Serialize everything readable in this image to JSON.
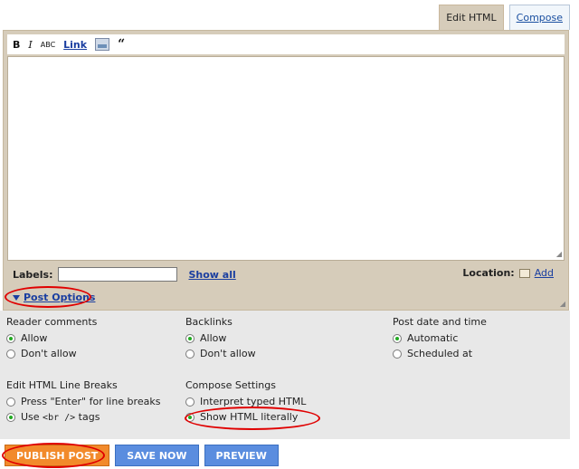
{
  "tabs": [
    {
      "label": "Edit HTML",
      "active": true
    },
    {
      "label": "Compose",
      "active": false
    }
  ],
  "toolbar": {
    "bold": "B",
    "italic": "I",
    "strike": "ABC",
    "link": "Link",
    "quote": "“"
  },
  "labels": {
    "label": "Labels:",
    "value": "",
    "show_all": "Show all"
  },
  "location": {
    "label": "Location:",
    "add": "Add"
  },
  "post_options": "Post Options",
  "groups": {
    "reader_comments": {
      "title": "Reader comments",
      "options": [
        {
          "label": "Allow",
          "selected": true
        },
        {
          "label": "Don't allow",
          "selected": false
        }
      ]
    },
    "backlinks": {
      "title": "Backlinks",
      "options": [
        {
          "label": "Allow",
          "selected": true
        },
        {
          "label": "Don't allow",
          "selected": false
        }
      ]
    },
    "post_date": {
      "title": "Post date and time",
      "options": [
        {
          "label": "Automatic",
          "selected": true
        },
        {
          "label": "Scheduled at",
          "selected": false
        }
      ]
    },
    "line_breaks": {
      "title": "Edit HTML Line Breaks",
      "options": [
        {
          "label": "Press \"Enter\" for line breaks",
          "selected": false
        },
        {
          "label_prefix": "Use ",
          "label_code": "<br />",
          "label_suffix": " tags",
          "selected": true
        }
      ]
    },
    "compose_settings": {
      "title": "Compose Settings",
      "options": [
        {
          "label": "Interpret typed HTML",
          "selected": false
        },
        {
          "label": "Show HTML literally",
          "selected": true
        }
      ]
    }
  },
  "buttons": {
    "publish": "PUBLISH POST",
    "save": "SAVE NOW",
    "preview": "PREVIEW"
  },
  "colors": {
    "editor_bg": "#d6ccba",
    "options_bg": "#e8e8e8",
    "link": "#1a3ea0",
    "publish": "#f28a2b",
    "secondary_button": "#5a8ddf",
    "annotation": "#e00000"
  }
}
